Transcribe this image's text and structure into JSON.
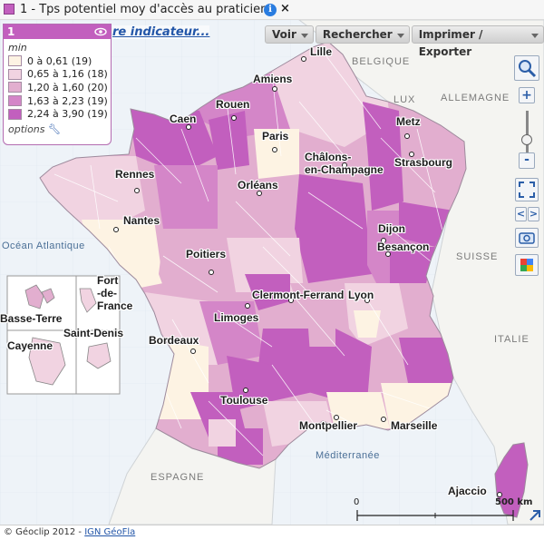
{
  "header": {
    "title": "1 - Tps potentiel moy d'accès au praticien",
    "info_icon": "info-icon",
    "close_label": "×"
  },
  "legend": {
    "number": "1",
    "unit": "min",
    "classes": [
      {
        "label": "0 à 0,61 (19)",
        "color": "#fdf3e3"
      },
      {
        "label": "0,65 à 1,16 (18)",
        "color": "#f1d3e1"
      },
      {
        "label": "1,20 à 1,60 (20)",
        "color": "#e2aecf"
      },
      {
        "label": "1,63 à 2,23 (19)",
        "color": "#d486c8"
      },
      {
        "label": "2,24 à 3,90 (19)",
        "color": "#c25fbe"
      }
    ],
    "options_label": "options"
  },
  "indicator_link": "re indicateur...",
  "toolbar": {
    "voir": "Voir",
    "rechercher": "Rechercher",
    "imprimer": "Imprimer / Exporter"
  },
  "map": {
    "cities": {
      "lille": "Lille",
      "amiens": "Amiens",
      "rouen": "Rouen",
      "caen": "Caen",
      "paris": "Paris",
      "metz": "Metz",
      "chalons": "Châlons-\nen-Champagne",
      "strasbourg": "Strasbourg",
      "rennes": "Rennes",
      "orleans": "Orléans",
      "nantes": "Nantes",
      "dijon": "Dijon",
      "besancon": "Besançon",
      "poitiers": "Poitiers",
      "clermont": "Clermont-Ferrand",
      "lyon": "Lyon",
      "limoges": "Limoges",
      "bordeaux": "Bordeaux",
      "toulouse": "Toulouse",
      "montpellier": "Montpellier",
      "marseille": "Marseille",
      "ajaccio": "Ajaccio"
    },
    "countries": {
      "belgique": "BELGIQUE",
      "lux": "LUX",
      "allemagne": "ALLEMAGNE",
      "suisse": "SUISSE",
      "italie": "ITALIE",
      "espagne": "ESPAGNE"
    },
    "seas": {
      "atlantique": "Océan Atlantique",
      "mediterranee": "Méditerranée"
    },
    "dom": {
      "basse_terre": "Basse-Terre",
      "fort_de_france": "Fort\n-de-\nFrance",
      "cayenne": "Cayenne",
      "saint_denis": "Saint-Denis"
    },
    "scale": {
      "start": "0",
      "end": "500 km"
    }
  },
  "controls": {
    "zoom_in": "+",
    "zoom_out": "-",
    "prev": "<",
    "next": ">",
    "icons": [
      "zoom-box-icon",
      "fullscreen-icon",
      "camera-icon",
      "google-earth-icon",
      "resize-corner-icon"
    ]
  },
  "footer": {
    "copyright": "© Géoclip 2012 - ",
    "link": "IGN GéoFla"
  }
}
